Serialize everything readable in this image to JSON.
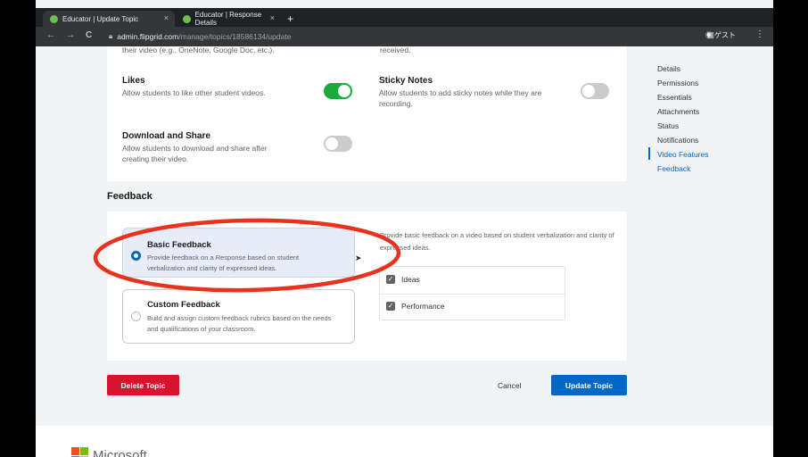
{
  "browser": {
    "tabs": [
      {
        "label": "Educator | Update Topic",
        "close": "×"
      },
      {
        "label": "Educator | Response Details",
        "close": "×"
      }
    ],
    "new_tab": "+",
    "back": "←",
    "forward": "→",
    "reload": "C",
    "url_domain": "admin.flipgrid.com",
    "url_path": "/manage/topics/18586134/update",
    "profile_label": "ゲスト",
    "menu": "⋮"
  },
  "settings": {
    "cut_left": "their video (e.g., OneNote, Google Doc, etc.).",
    "cut_right": "received.",
    "likes": {
      "title": "Likes",
      "desc": "Allow students to like other student videos.",
      "enabled": true
    },
    "sticky_notes": {
      "title": "Sticky Notes",
      "desc": "Allow students to add sticky notes while they are recording.",
      "enabled": false
    },
    "download_share": {
      "title": "Download and Share",
      "desc": "Allow students to download and share after creating their video.",
      "enabled": false
    }
  },
  "side_nav": {
    "items": [
      "Details",
      "Permissions",
      "Essentials",
      "Attachments",
      "Status",
      "Notifications",
      "Video Features",
      "Feedback"
    ],
    "active": "Video Features"
  },
  "feedback": {
    "heading": "Feedback",
    "basic": {
      "title": "Basic Feedback",
      "desc": "Provide feedback on a Response based on student verbalization and clarity of expressed ideas.",
      "selected": true
    },
    "custom": {
      "title": "Custom Feedback",
      "desc": "Build and assign custom feedback rubrics based on the needs and qualifications of your classroom.",
      "selected": false
    },
    "explain": "Provide basic feedback on a video based on student verbalization and clarity of expressed ideas.",
    "criteria": [
      {
        "label": "Ideas",
        "checked": true
      },
      {
        "label": "Performance",
        "checked": true
      }
    ]
  },
  "actions": {
    "delete": "Delete Topic",
    "cancel": "Cancel",
    "update": "Update Topic"
  },
  "footer": {
    "brand": "Microsoft"
  },
  "colors": {
    "primary": "#0067c5",
    "danger": "#d8132e",
    "toggle_on": "#1aab3c",
    "annotation": "#e8321e"
  }
}
